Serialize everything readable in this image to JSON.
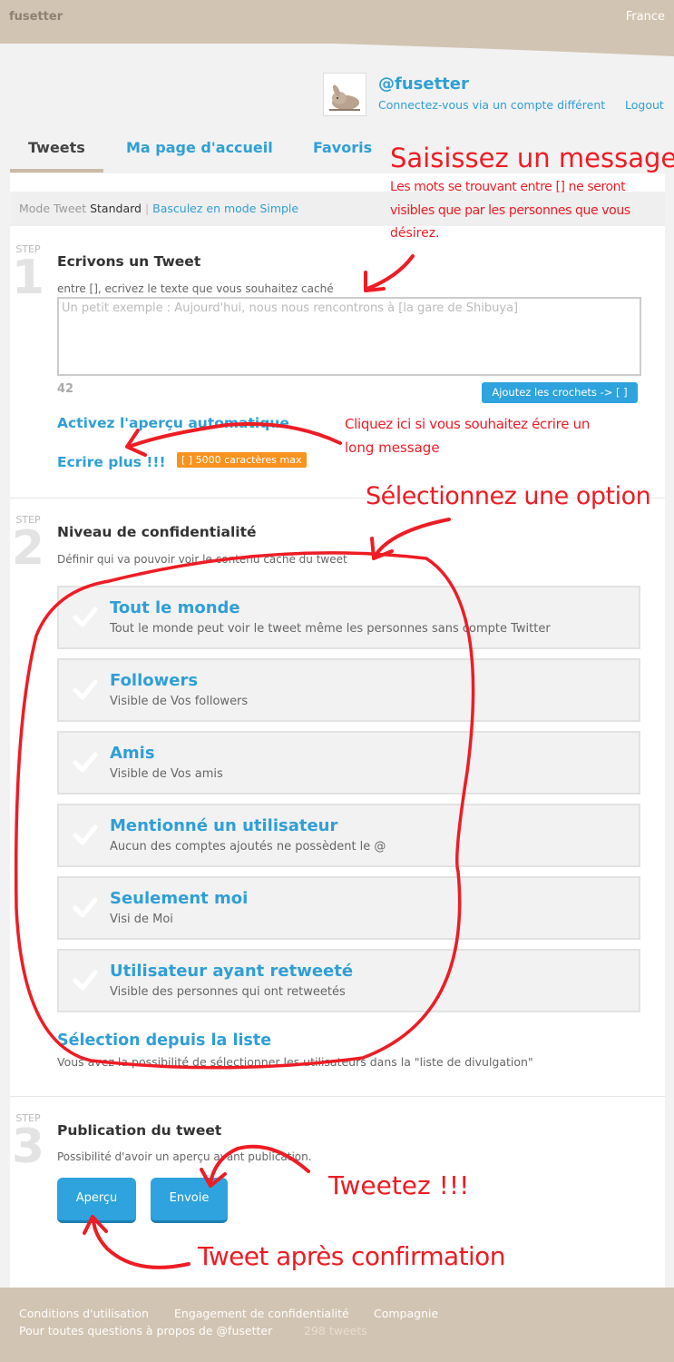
{
  "header": {
    "brand": "fusetter",
    "language": "France"
  },
  "user": {
    "handle": "@fusetter",
    "switch_account": "Connectez-vous via un compte différent",
    "logout": "Logout"
  },
  "tabs": [
    {
      "label": "Tweets",
      "active": true
    },
    {
      "label": "Ma page d'accueil",
      "active": false
    },
    {
      "label": "Favoris",
      "active": false
    }
  ],
  "mode": {
    "label": "Mode Tweet",
    "current": "Standard",
    "separator": "|",
    "switch_link": "Basculez en mode Simple"
  },
  "step_word": "STEP",
  "step1": {
    "number": "1",
    "title": "Ecrivons un Tweet",
    "hint": "entre [], ecrivez le texte que vous souhaitez caché",
    "placeholder": "Un petit exemple : Aujourd'hui, nous nous rencontrons à [la gare de Shibuya]",
    "char_count": "42",
    "brackets_button": "Ajoutez les crochets -> [ ]",
    "auto_preview": "Activez l'aperçu automatique",
    "write_more": "Ecrire plus !!!",
    "max_badge": "[ ] 5000 caractères max"
  },
  "step2": {
    "number": "2",
    "title": "Niveau de confidentialité",
    "hint": "Définir qui va pouvoir voir le contenu caché du tweet",
    "options": [
      {
        "title": "Tout le monde",
        "desc": "Tout le monde peut voir le tweet même les personnes sans compte Twitter"
      },
      {
        "title": "Followers",
        "desc": "Visible de Vos followers"
      },
      {
        "title": "Amis",
        "desc": "Visible de Vos amis"
      },
      {
        "title": "Mentionné un utilisateur",
        "desc": "Aucun des comptes ajoutés ne possèdent le @"
      },
      {
        "title": "Seulement moi",
        "desc": "Visi de Moi"
      },
      {
        "title": "Utilisateur ayant retweeté",
        "desc": "Visible des personnes qui ont retweetés"
      }
    ],
    "list_select": "Sélection depuis la liste",
    "list_hint": "Vous avez la possibilité de sélectionner les utilisateurs dans la \"liste de divulgation\""
  },
  "step3": {
    "number": "3",
    "title": "Publication du tweet",
    "hint": "Possibilité d'avoir un aperçu avant publication.",
    "preview_button": "Aperçu",
    "send_button": "Envoie"
  },
  "footer": {
    "terms": "Conditions d'utilisation",
    "privacy": "Engagement de confidentialité",
    "company": "Compagnie",
    "questions": "Pour toutes questions à propos de @fusetter",
    "tweet_count": "298 tweets"
  },
  "annotations": {
    "enter_message": "Saisissez un message",
    "enter_message_detail_1": "Les mots se trouvant entre [] ne seront",
    "enter_message_detail_2": "visibles que par les personnes que vous",
    "enter_message_detail_3": "désirez.",
    "long_message_1": "Cliquez ici si vous souhaitez écrire un",
    "long_message_2": "long message",
    "select_option": "Sélectionnez une option",
    "tweet_now": "Tweetez !!!",
    "tweet_after_confirm": "Tweet après confirmation"
  },
  "colors": {
    "accent": "#2f9fd6",
    "header_bg": "#d2c4b2",
    "badge": "#f7931e",
    "annotation": "#ee1c24"
  }
}
